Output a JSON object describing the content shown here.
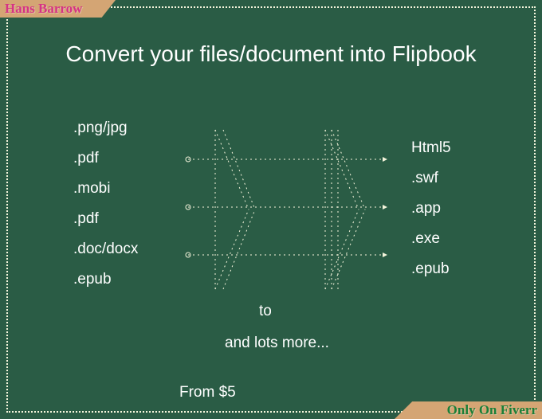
{
  "author": "Hans Barrow",
  "platform": "Only On Fiverr",
  "headline": "Convert your files/document into Flipbook",
  "leftFormats": {
    "f0": ".png/jpg",
    "f1": ".pdf",
    "f2": ".mobi",
    "f3": ".pdf",
    "f4": ".doc/docx",
    "f5": ".epub"
  },
  "rightFormats": {
    "f0": "Html5",
    "f1": ".swf",
    "f2": ".app",
    "f3": ".exe",
    "f4": ".epub"
  },
  "toLabel": "to",
  "moreLabel": "and lots more...",
  "priceLabel": "From $5"
}
